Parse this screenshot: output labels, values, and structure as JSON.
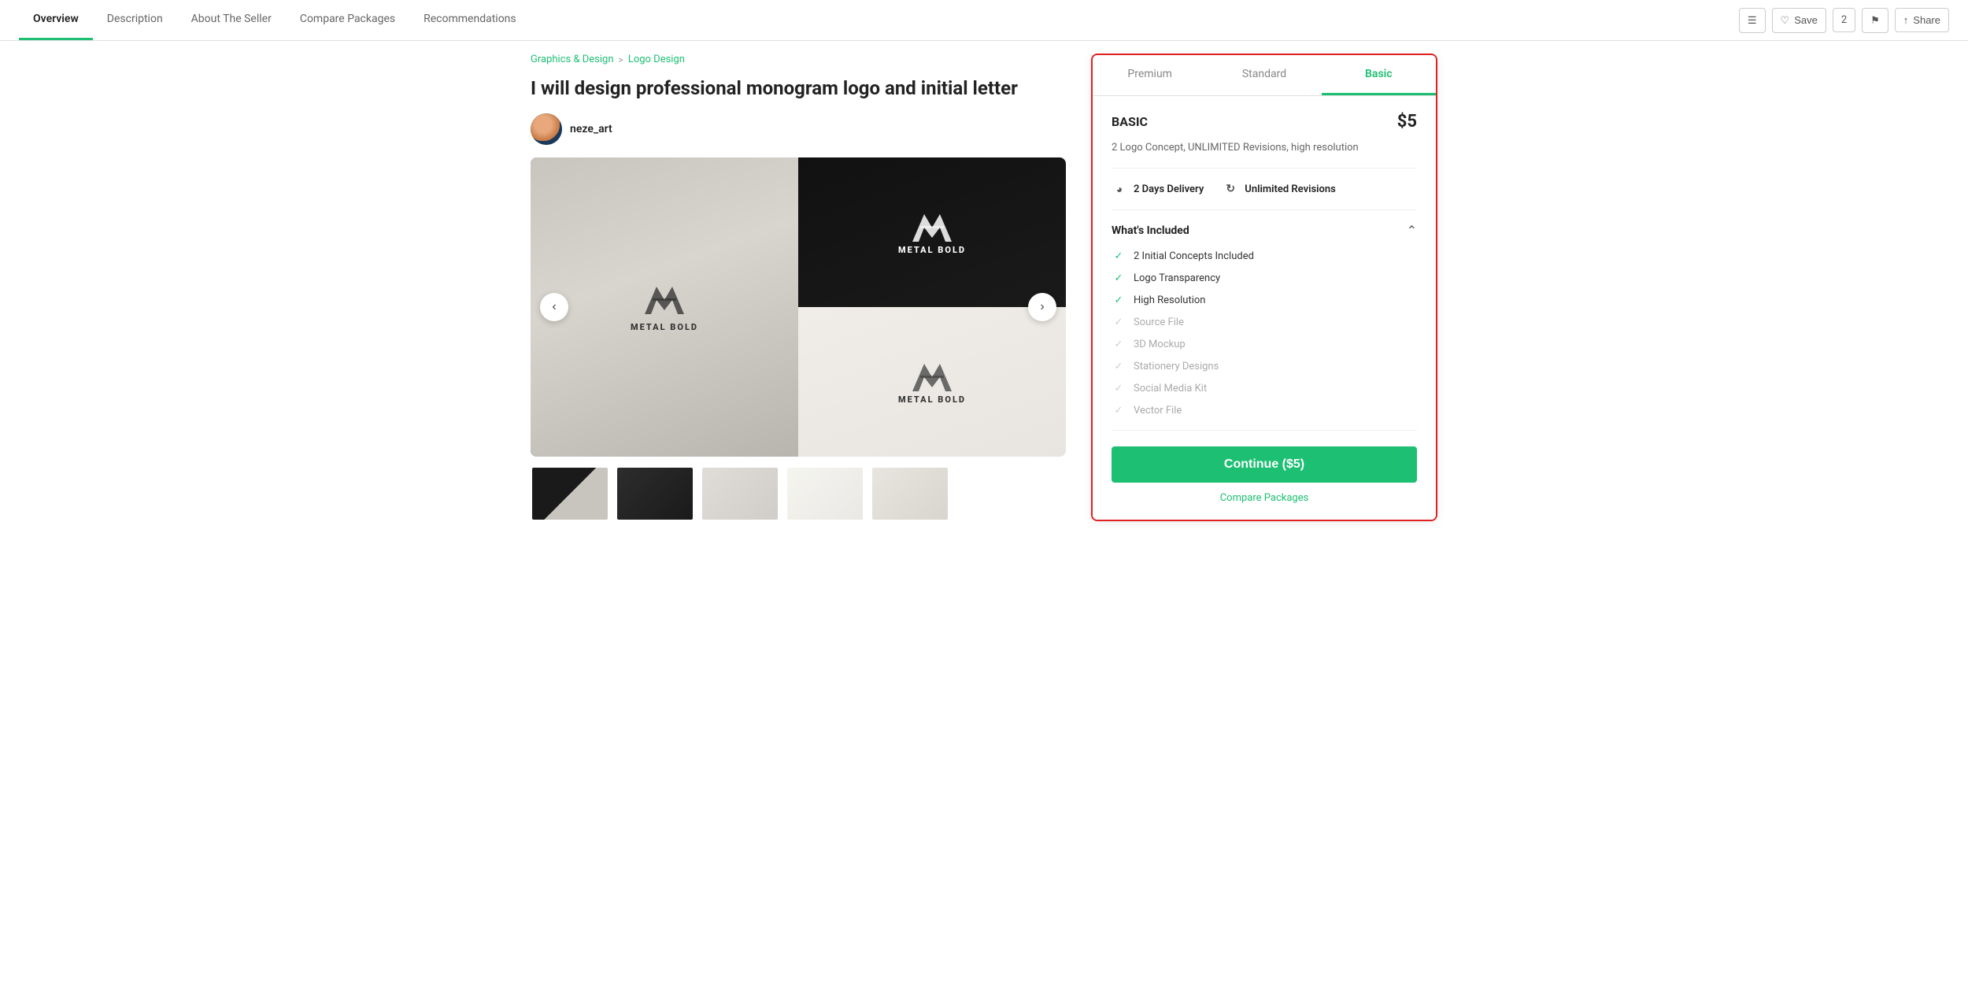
{
  "nav": {
    "tabs": [
      {
        "id": "overview",
        "label": "Overview",
        "active": true
      },
      {
        "id": "description",
        "label": "Description",
        "active": false
      },
      {
        "id": "about-seller",
        "label": "About The Seller",
        "active": false
      },
      {
        "id": "compare-packages",
        "label": "Compare Packages",
        "active": false
      },
      {
        "id": "recommendations",
        "label": "Recommendations",
        "active": false
      }
    ],
    "actions": {
      "menu_label": "☰",
      "save_label": "Save",
      "save_count": "2",
      "flag_label": "⚑",
      "share_label": "Share"
    }
  },
  "breadcrumb": {
    "part1": "Graphics & Design",
    "separator": ">",
    "part2": "Logo Design"
  },
  "gig": {
    "title": "I will design professional monogram logo and initial letter",
    "seller_name": "neze_art"
  },
  "package": {
    "tabs": [
      {
        "id": "premium",
        "label": "Premium",
        "active": false
      },
      {
        "id": "standard",
        "label": "Standard",
        "active": false
      },
      {
        "id": "basic",
        "label": "Basic",
        "active": true
      }
    ],
    "active_tab": "basic",
    "name": "BASIC",
    "price": "$5",
    "description": "2 Logo Concept, UNLIMITED Revisions, high resolution",
    "delivery_days": "2 Days Delivery",
    "revisions": "Unlimited Revisions",
    "whats_included_title": "What's Included",
    "included_items": [
      {
        "label": "2 Initial Concepts Included",
        "active": true
      },
      {
        "label": "Logo Transparency",
        "active": true
      },
      {
        "label": "High Resolution",
        "active": true
      },
      {
        "label": "Source File",
        "active": false
      },
      {
        "label": "3D Mockup",
        "active": false
      },
      {
        "label": "Stationery Designs",
        "active": false
      },
      {
        "label": "Social Media Kit",
        "active": false
      },
      {
        "label": "Vector File",
        "active": false
      }
    ],
    "continue_btn_label": "Continue ($5)",
    "compare_packages_label": "Compare Packages"
  },
  "thumbnails": [
    {
      "id": 1,
      "class": "thumb-1"
    },
    {
      "id": 2,
      "class": "thumb-2"
    },
    {
      "id": 3,
      "class": "thumb-3"
    },
    {
      "id": 4,
      "class": "thumb-4"
    },
    {
      "id": 5,
      "class": "thumb-5"
    }
  ],
  "colors": {
    "accent": "#1dbf73",
    "danger": "#e02020",
    "text_primary": "#222",
    "text_secondary": "#666"
  }
}
